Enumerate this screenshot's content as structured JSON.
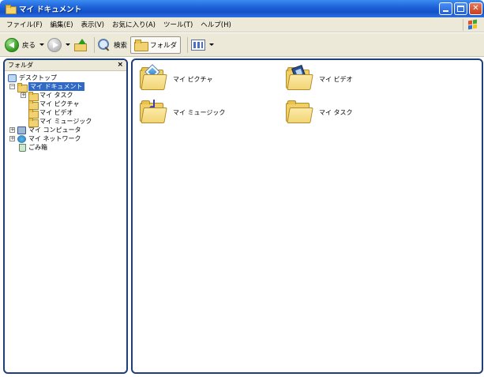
{
  "window": {
    "title": "マイ ドキュメント",
    "buttons": {
      "minimize": "minimize-button",
      "maximize": "maximize-button",
      "close": "close-button"
    }
  },
  "menubar": {
    "items": [
      {
        "label": "ファイル(F)"
      },
      {
        "label": "編集(E)"
      },
      {
        "label": "表示(V)"
      },
      {
        "label": "お気に入り(A)"
      },
      {
        "label": "ツール(T)"
      },
      {
        "label": "ヘルプ(H)"
      }
    ]
  },
  "toolbar": {
    "back_label": "戻る",
    "search_label": "検索",
    "folders_label": "フォルダ"
  },
  "folder_pane": {
    "header": "フォルダ",
    "close_glyph": "×",
    "tree": [
      {
        "label": "デスクトップ",
        "icon": "desktop-icon",
        "expander": ""
      },
      {
        "label": "マイ ドキュメント",
        "icon": "folder-icon",
        "expander": "−",
        "selected": true
      },
      {
        "label": "マイ タスク",
        "icon": "folder-icon",
        "expander": "+"
      },
      {
        "label": "マイ ピクチャ",
        "icon": "pictures-folder-icon",
        "expander": ""
      },
      {
        "label": "マイ ビデオ",
        "icon": "videos-folder-icon",
        "expander": ""
      },
      {
        "label": "マイ ミュージック",
        "icon": "music-folder-icon",
        "expander": ""
      },
      {
        "label": "マイ コンピュータ",
        "icon": "computer-icon",
        "expander": "+"
      },
      {
        "label": "マイ ネットワーク",
        "icon": "network-icon",
        "expander": "+"
      },
      {
        "label": "ごみ箱",
        "icon": "recycle-bin-icon",
        "expander": ""
      }
    ]
  },
  "content": {
    "items": [
      {
        "label": "マイ ピクチャ",
        "icon": "pictures-folder-icon"
      },
      {
        "label": "マイ ビデオ",
        "icon": "videos-folder-icon"
      },
      {
        "label": "マイ ミュージック",
        "icon": "music-folder-icon"
      },
      {
        "label": "マイ タスク",
        "icon": "folder-icon"
      }
    ]
  },
  "colors": {
    "titlebar_blue": "#1b5fd6",
    "chrome_beige": "#ece9d8",
    "selection_blue": "#316ac5",
    "pane_outline": "#1f3f7a",
    "folder_yellow": "#f2d270"
  }
}
